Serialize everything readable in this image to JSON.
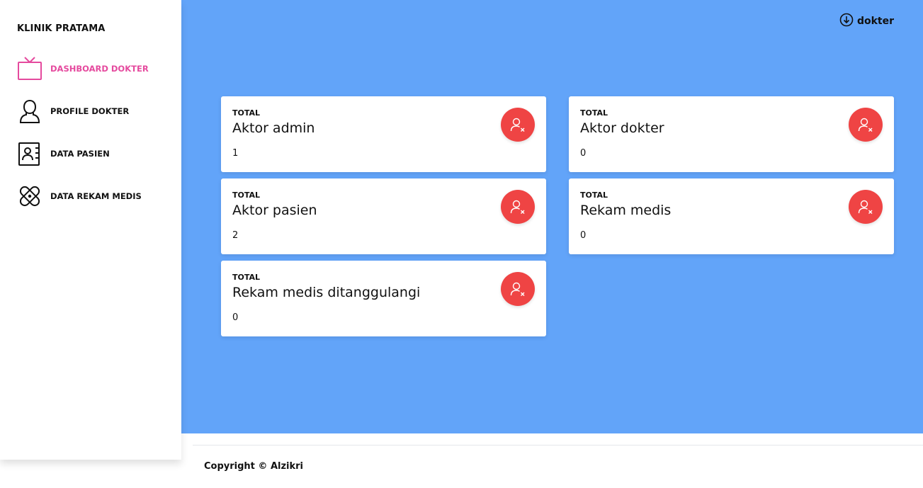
{
  "sidebar": {
    "brand": "KLINIK PRATAMA",
    "items": [
      {
        "label": "DASHBOARD DOKTER",
        "icon": "tv-icon",
        "active": true
      },
      {
        "label": "PROFILE DOKTER",
        "icon": "user-outline-icon",
        "active": false
      },
      {
        "label": "DATA PASIEN",
        "icon": "contact-book-icon",
        "active": false
      },
      {
        "label": "DATA REKAM MEDIS",
        "icon": "bandage-icon",
        "active": false
      }
    ]
  },
  "header": {
    "user_name": "dokter",
    "user_icon": "arrow-down-circle-icon"
  },
  "cards": [
    {
      "label": "TOTAL",
      "title": "Aktor admin",
      "value": "1",
      "icon": "user-remove-icon"
    },
    {
      "label": "TOTAL",
      "title": "Aktor dokter",
      "value": "0",
      "icon": "user-remove-icon"
    },
    {
      "label": "TOTAL",
      "title": "Aktor pasien",
      "value": "2",
      "icon": "user-remove-icon"
    },
    {
      "label": "TOTAL",
      "title": "Rekam medis",
      "value": "0",
      "icon": "user-remove-icon"
    },
    {
      "label": "TOTAL",
      "title": "Rekam medis ditanggulangi",
      "value": "0",
      "icon": "user-remove-icon"
    }
  ],
  "footer": {
    "copyright": "Copyright © Alzikri"
  },
  "colors": {
    "main_bg": "#62a4f9",
    "active_nav": "#e54a9e",
    "card_icon_bg": "#ef4444"
  }
}
